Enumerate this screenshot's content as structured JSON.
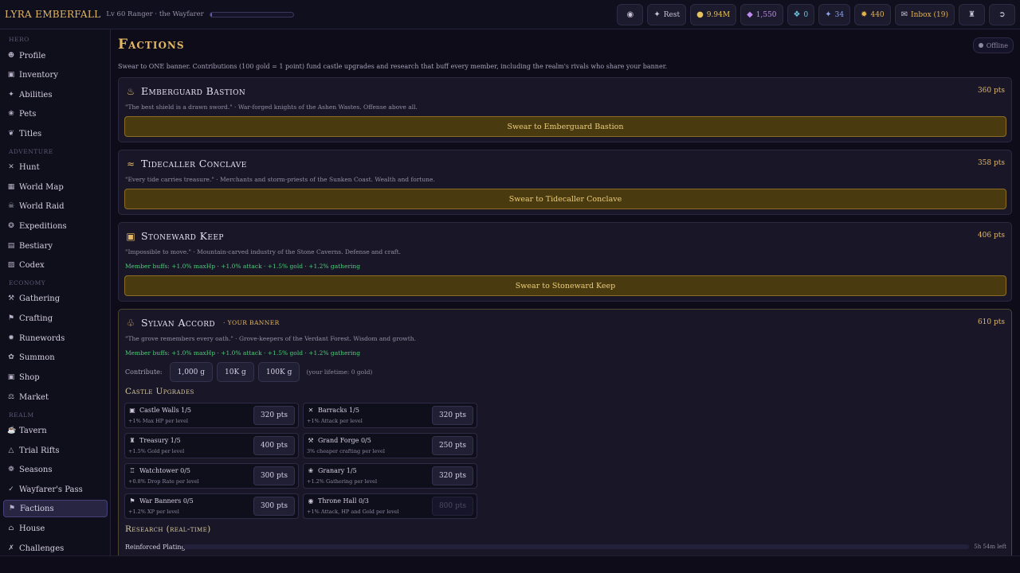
{
  "hero": {
    "name": "Lyra Emberfall",
    "subtitle": "Lv 60 Ranger · the Wayfarer",
    "xp_progress": 0.02
  },
  "topbar": {
    "rest_label": "Rest",
    "gold": "9.94M",
    "gems": "1,550",
    "shards": "0",
    "runes": "34",
    "sparks": "440",
    "inbox_label": "Inbox (19)",
    "icons": [
      "menu-icon",
      "rest-icon",
      "gold-icon",
      "gem-icon",
      "shard-icon",
      "rune-icon",
      "spark-icon",
      "mail-icon",
      "castle-icon",
      "logout-icon"
    ]
  },
  "sidebar": {
    "sections": [
      {
        "label": "Hero",
        "items": [
          {
            "label": "Profile",
            "icon": "person-icon"
          },
          {
            "label": "Inventory",
            "icon": "chest-icon"
          },
          {
            "label": "Abilities",
            "icon": "sparkle-icon"
          },
          {
            "label": "Pets",
            "icon": "paw-icon"
          },
          {
            "label": "Titles",
            "icon": "ribbon-icon"
          }
        ]
      },
      {
        "label": "Adventure",
        "items": [
          {
            "label": "Hunt",
            "icon": "swords-icon"
          },
          {
            "label": "World Map",
            "icon": "map-icon"
          },
          {
            "label": "World Raid",
            "icon": "skull-icon"
          },
          {
            "label": "Expeditions",
            "icon": "compass-icon"
          },
          {
            "label": "Bestiary",
            "icon": "book-icon"
          },
          {
            "label": "Codex",
            "icon": "scroll-icon"
          }
        ]
      },
      {
        "label": "Economy",
        "items": [
          {
            "label": "Gathering",
            "icon": "pickaxe-icon"
          },
          {
            "label": "Crafting",
            "icon": "hammer-icon"
          },
          {
            "label": "Runewords",
            "icon": "rune-icon"
          },
          {
            "label": "Summon",
            "icon": "portal-icon"
          },
          {
            "label": "Shop",
            "icon": "shop-icon"
          },
          {
            "label": "Market",
            "icon": "scale-icon"
          }
        ]
      },
      {
        "label": "Realm",
        "items": [
          {
            "label": "Tavern",
            "icon": "mug-icon"
          },
          {
            "label": "Trial Rifts",
            "icon": "rift-icon"
          },
          {
            "label": "Seasons",
            "icon": "leaf-icon"
          },
          {
            "label": "Wayfarer's Pass",
            "icon": "pass-icon"
          },
          {
            "label": "Factions",
            "icon": "flag-icon"
          },
          {
            "label": "House",
            "icon": "house-icon"
          },
          {
            "label": "Challenges",
            "icon": "crossed-swords-icon"
          }
        ]
      }
    ],
    "active": "Factions"
  },
  "page": {
    "title": "Factions",
    "status": "Offline",
    "intro": "Swear to ONE banner. Contributions (100 gold = 1 point) fund castle upgrades and research that buff every member, including the realm's rivals who share your banner."
  },
  "factions": [
    {
      "name": "Emberguard Bastion",
      "icon": "flame-icon",
      "points": "360 pts",
      "quote": "\"The best shield is a drawn sword.\" · War-forged knights of the Ashen Wastes. Offense above all.",
      "buffs": "",
      "swear_label": "Swear to Emberguard Bastion"
    },
    {
      "name": "Tidecaller Conclave",
      "icon": "wave-icon",
      "points": "358 pts",
      "quote": "\"Every tide carries treasure.\" · Merchants and storm-priests of the Sunken Coast. Wealth and fortune.",
      "buffs": "",
      "swear_label": "Swear to Tidecaller Conclave"
    },
    {
      "name": "Stoneward Keep",
      "icon": "stone-icon",
      "points": "406 pts",
      "quote": "\"Impossible to move.\" · Mountain-carved industry of the Stone Caverns. Defense and craft.",
      "buffs": "Member buffs: +1.0% maxHp · +1.0% attack · +1.5% gold · +1.2% gathering",
      "swear_label": "Swear to Stoneward Keep"
    },
    {
      "name": "Sylvan Accord",
      "icon": "tree-icon",
      "points": "610 pts",
      "your_banner": "· Your banner",
      "quote": "\"The grove remembers every oath.\" · Grove-keepers of the Verdant Forest. Wisdom and growth.",
      "buffs": "Member buffs: +1.0% maxHp · +1.0% attack · +1.5% gold · +1.2% gathering"
    }
  ],
  "contribute": {
    "label": "Contribute:",
    "options": [
      "1,000 g",
      "10K g",
      "100K g"
    ],
    "lifetime": "(your lifetime: 0 gold)"
  },
  "castle": {
    "title": "Castle Upgrades",
    "upgrades": [
      {
        "name": "Castle Walls 1/5",
        "desc": "+1% Max HP per level",
        "cost": "320 pts",
        "icon": "wall-icon",
        "disabled": false
      },
      {
        "name": "Barracks 1/5",
        "desc": "+1% Attack per level",
        "cost": "320 pts",
        "icon": "swords-icon",
        "disabled": false
      },
      {
        "name": "Treasury 1/5",
        "desc": "+1.5% Gold per level",
        "cost": "400 pts",
        "icon": "treasury-icon",
        "disabled": false
      },
      {
        "name": "Grand Forge 0/5",
        "desc": "3% cheaper crafting per level",
        "cost": "250 pts",
        "icon": "anvil-icon",
        "disabled": false
      },
      {
        "name": "Watchtower 0/5",
        "desc": "+0.8% Drop Rate per level",
        "cost": "300 pts",
        "icon": "tower-icon",
        "disabled": false
      },
      {
        "name": "Granary 1/5",
        "desc": "+1.2% Gathering per level",
        "cost": "320 pts",
        "icon": "wheat-icon",
        "disabled": false
      },
      {
        "name": "War Banners 0/5",
        "desc": "+1.2% XP per level",
        "cost": "300 pts",
        "icon": "banner-icon",
        "disabled": false
      },
      {
        "name": "Throne Hall 0/3",
        "desc": "+1% Attack, HP and Gold per level",
        "cost": "800 pts",
        "icon": "throne-icon",
        "disabled": true
      }
    ]
  },
  "research": {
    "title": "Research (real-time)",
    "items": [
      {
        "name": "Reinforced Plating",
        "progress": 0.0,
        "time_left": "5h 54m left"
      }
    ]
  }
}
